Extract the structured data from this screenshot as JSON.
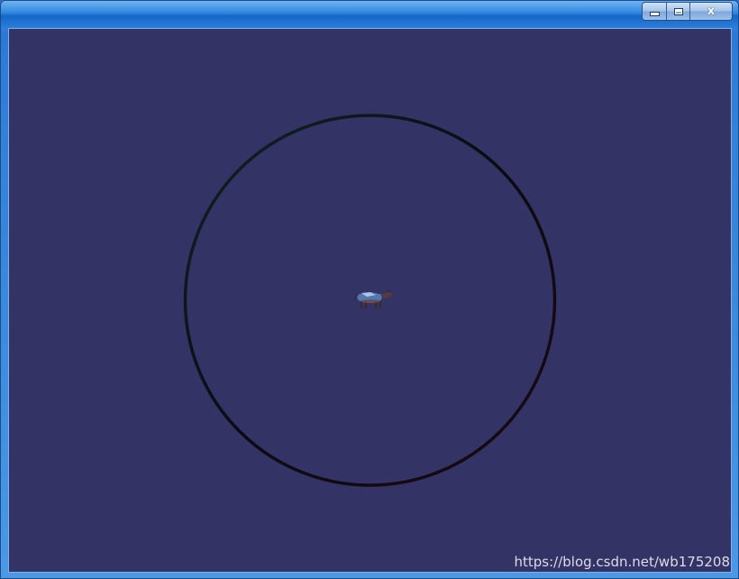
{
  "window": {
    "title": "",
    "caption_buttons": {
      "minimize_icon": "minimize-icon",
      "maximize_icon": "maximize-icon",
      "close_icon": "close-icon",
      "close_glyph": "x"
    }
  },
  "viewport": {
    "background_color": "#333366",
    "circle_color": "#0d0d14",
    "model": {
      "name": "cow-model",
      "description_icon": "cow-icon"
    }
  },
  "watermark": {
    "text": "https://blog.csdn.net/wb175208"
  }
}
